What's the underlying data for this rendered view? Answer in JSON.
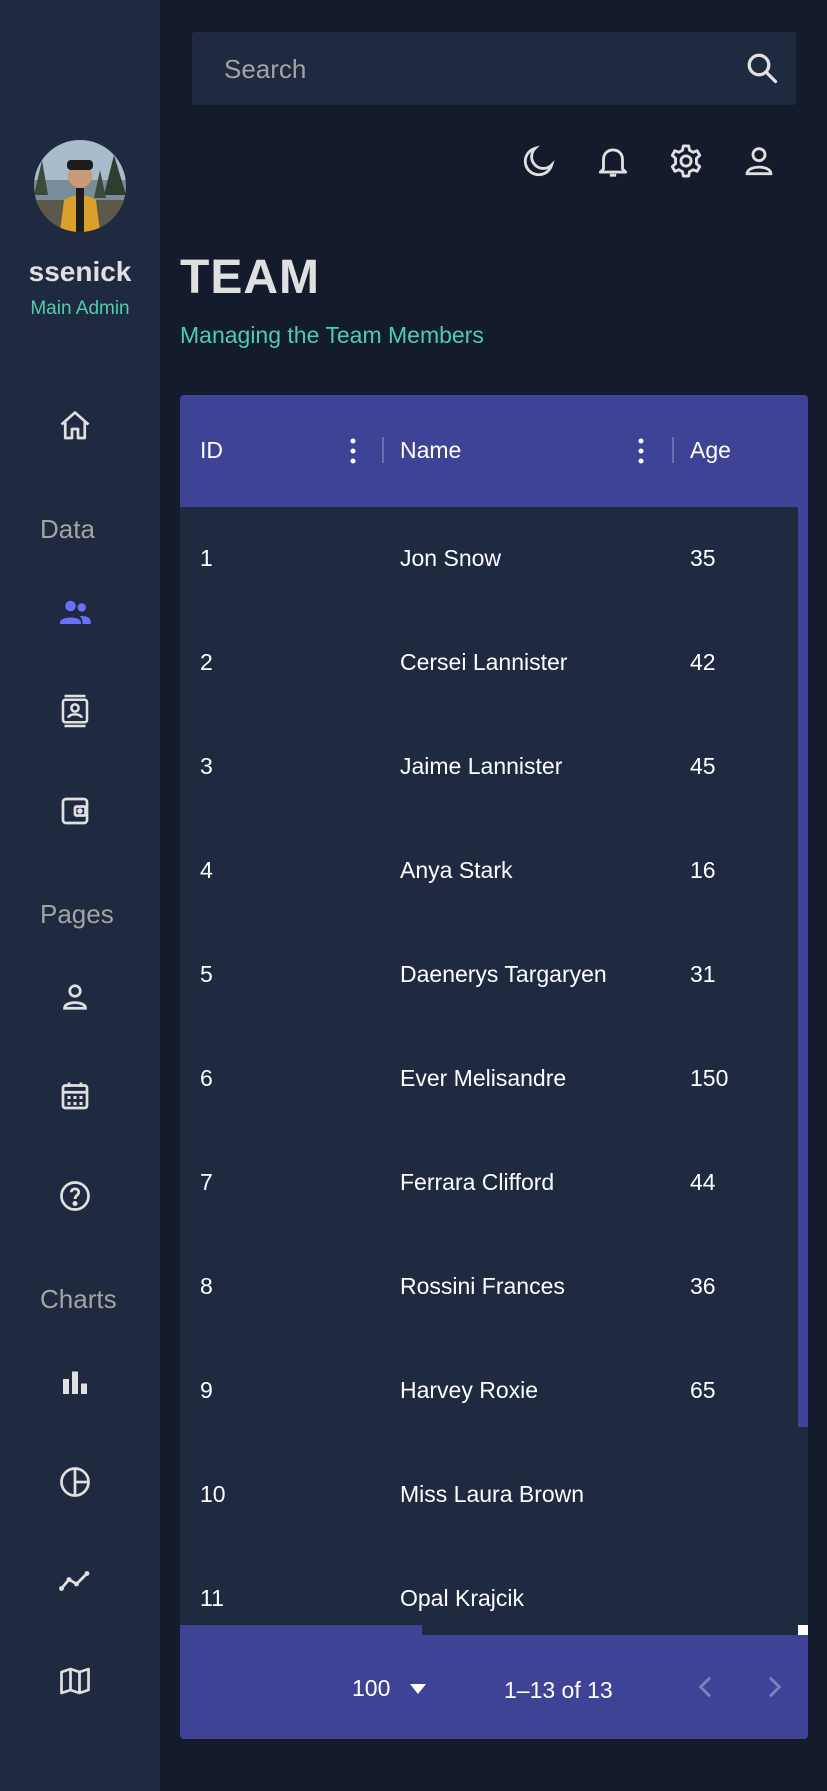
{
  "search": {
    "placeholder": "Search"
  },
  "topbar": {
    "icons": [
      "moon-icon",
      "bell-icon",
      "gear-icon",
      "person-icon"
    ]
  },
  "user": {
    "name": "ssenick",
    "role": "Main Admin"
  },
  "sidebar": {
    "sections": [
      "Data",
      "Pages",
      "Charts"
    ],
    "items": [
      "home-icon",
      "people-icon",
      "contacts-icon",
      "wallet-icon",
      "person-icon",
      "calendar-icon",
      "help-icon",
      "bar-chart-icon",
      "pie-chart-icon",
      "line-chart-icon",
      "map-icon"
    ]
  },
  "page": {
    "title": "TEAM",
    "subtitle": "Managing the Team Members"
  },
  "table": {
    "columns": [
      "ID",
      "Name",
      "Age"
    ],
    "rows": [
      {
        "id": "1",
        "name": "Jon Snow",
        "age": "35"
      },
      {
        "id": "2",
        "name": "Cersei Lannister",
        "age": "42"
      },
      {
        "id": "3",
        "name": "Jaime Lannister",
        "age": "45"
      },
      {
        "id": "4",
        "name": "Anya Stark",
        "age": "16"
      },
      {
        "id": "5",
        "name": "Daenerys Targaryen",
        "age": "31"
      },
      {
        "id": "6",
        "name": "Ever Melisandre",
        "age": "150"
      },
      {
        "id": "7",
        "name": "Ferrara Clifford",
        "age": "44"
      },
      {
        "id": "8",
        "name": "Rossini Frances",
        "age": "36"
      },
      {
        "id": "9",
        "name": "Harvey Roxie",
        "age": "65"
      },
      {
        "id": "10",
        "name": "Miss Laura Brown",
        "age": ""
      },
      {
        "id": "11",
        "name": "Opal Krajcik",
        "age": ""
      }
    ]
  },
  "pagination": {
    "rows_per_page": "100",
    "range": "1–13 of 13"
  },
  "colors": {
    "accent": "#3e4396",
    "green": "#4cceac",
    "active_icon": "#6870fa",
    "panel": "#1f2a40",
    "background": "#141b2d"
  }
}
